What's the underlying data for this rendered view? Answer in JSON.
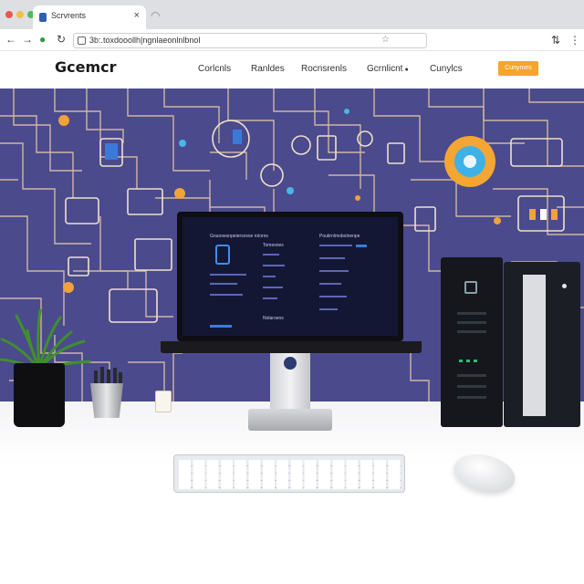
{
  "browser": {
    "tab_title": "Scrvrents",
    "tab_close_icon": "close-icon",
    "new_tab_icon": "new-tab-icon",
    "address_url": "3b:.toxdooollh|ngnlaeonlnlbnol",
    "window_dot_colors": [
      "#e9574e",
      "#f1c04a",
      "#4dbd5a"
    ]
  },
  "site": {
    "logo": "Gcemcr",
    "nav": [
      "Corlcnls",
      "Ranldes",
      "Rocnsrenls",
      "Gcrnlicnt"
    ],
    "nav_last": "Cunylcs",
    "cta_label": "Cunymes",
    "accent_color": "#f4a52a",
    "hero_color": "#4a4a8c"
  },
  "screen": {
    "heading_left": "Gouooesnpeiersovse rolorns",
    "heading_right": "Poutirnlmobolnenpe",
    "tabs": [
      "Tomesnes",
      "Nolaroens"
    ]
  }
}
